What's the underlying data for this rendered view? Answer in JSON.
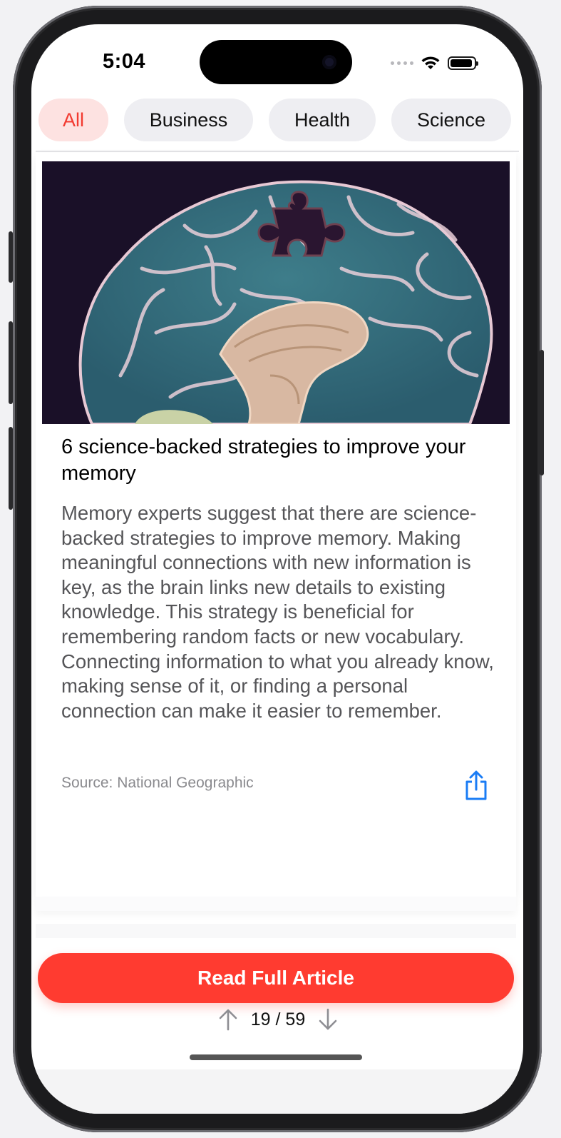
{
  "status_bar": {
    "time": "5:04"
  },
  "tabs": [
    {
      "label": "All",
      "active": true
    },
    {
      "label": "Business",
      "active": false
    },
    {
      "label": "Health",
      "active": false
    },
    {
      "label": "Science",
      "active": false
    }
  ],
  "article": {
    "image_subject": "brain-with-missing-puzzle-piece",
    "title": "6 science-backed strategies to improve your memory",
    "body": "Memory experts suggest that there are science-backed strategies to improve memory. Making meaningful connections with new information is key, as the brain links new details to existing knowledge. This strategy is beneficial for remembering random facts or new vocabulary. Connecting information to what you already know, making sense of it, or finding a personal connection can make it easier to remember.",
    "source": "Source: National Geographic",
    "share_icon": "share-icon"
  },
  "actions": {
    "read_full_label": "Read Full Article"
  },
  "pagination": {
    "counter": "19 / 59",
    "up_icon": "arrow-up-icon",
    "down_icon": "arrow-down-icon"
  },
  "colors": {
    "accent": "#ff3b30",
    "tab_active_bg": "#fde2e1",
    "tab_bg": "#eeeef2",
    "share_blue": "#1a7cf5"
  }
}
